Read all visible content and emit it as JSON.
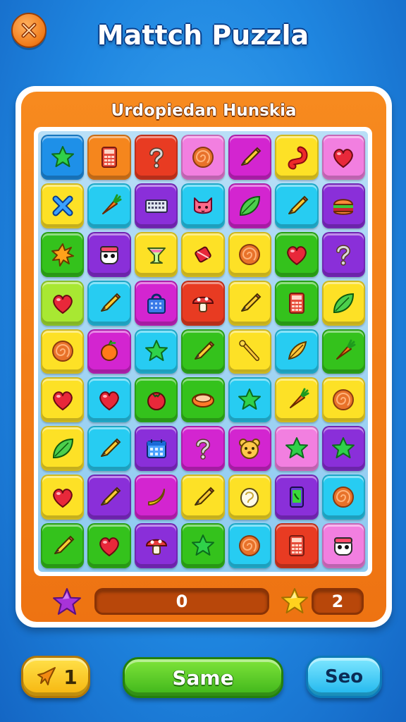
{
  "header": {
    "title": "Mattch Puzzla",
    "close_icon": "close-icon"
  },
  "panel": {
    "subtitle": "Urdopiedan Hunskia"
  },
  "board": {
    "columns": 7,
    "rows": 9,
    "tiles": [
      {
        "color": "blue",
        "icon": "star"
      },
      {
        "color": "orange",
        "icon": "calculator"
      },
      {
        "color": "red",
        "icon": "question"
      },
      {
        "color": "pink",
        "icon": "swirl"
      },
      {
        "color": "magenta",
        "icon": "pencil"
      },
      {
        "color": "yellow",
        "icon": "hook"
      },
      {
        "color": "pink",
        "icon": "heart"
      },
      {
        "color": "yellow",
        "icon": "cross"
      },
      {
        "color": "cyan",
        "icon": "carrot"
      },
      {
        "color": "purple",
        "icon": "keyboard"
      },
      {
        "color": "cyan",
        "icon": "cat"
      },
      {
        "color": "magenta",
        "icon": "leaf"
      },
      {
        "color": "cyan",
        "icon": "pencil"
      },
      {
        "color": "purple",
        "icon": "burger"
      },
      {
        "color": "green",
        "icon": "burst"
      },
      {
        "color": "purple",
        "icon": "face"
      },
      {
        "color": "yellow",
        "icon": "cup"
      },
      {
        "color": "yellow",
        "icon": "candy"
      },
      {
        "color": "yellow",
        "icon": "swirl"
      },
      {
        "color": "green",
        "icon": "heart"
      },
      {
        "color": "purple",
        "icon": "question"
      },
      {
        "color": "lime",
        "icon": "heart"
      },
      {
        "color": "cyan",
        "icon": "pencil"
      },
      {
        "color": "magenta",
        "icon": "bag"
      },
      {
        "color": "red",
        "icon": "mushroom"
      },
      {
        "color": "yellow",
        "icon": "pencil"
      },
      {
        "color": "green",
        "icon": "calculator"
      },
      {
        "color": "yellow",
        "icon": "leaf"
      },
      {
        "color": "yellow",
        "icon": "swirl"
      },
      {
        "color": "magenta",
        "icon": "fruit"
      },
      {
        "color": "cyan",
        "icon": "star"
      },
      {
        "color": "green",
        "icon": "pencil"
      },
      {
        "color": "yellow",
        "icon": "wand"
      },
      {
        "color": "cyan",
        "icon": "feather"
      },
      {
        "color": "green",
        "icon": "carrot"
      },
      {
        "color": "yellow",
        "icon": "heart"
      },
      {
        "color": "cyan",
        "icon": "heart"
      },
      {
        "color": "green",
        "icon": "tomato"
      },
      {
        "color": "green",
        "icon": "bowl"
      },
      {
        "color": "cyan",
        "icon": "star"
      },
      {
        "color": "yellow",
        "icon": "carrot"
      },
      {
        "color": "yellow",
        "icon": "swirl"
      },
      {
        "color": "yellow",
        "icon": "leaf"
      },
      {
        "color": "cyan",
        "icon": "pencil"
      },
      {
        "color": "purple",
        "icon": "calendar"
      },
      {
        "color": "magenta",
        "icon": "question"
      },
      {
        "color": "magenta",
        "icon": "bear"
      },
      {
        "color": "pink",
        "icon": "star"
      },
      {
        "color": "purple",
        "icon": "star"
      },
      {
        "color": "yellow",
        "icon": "heart"
      },
      {
        "color": "purple",
        "icon": "pencil"
      },
      {
        "color": "magenta",
        "icon": "banana"
      },
      {
        "color": "yellow",
        "icon": "pencil"
      },
      {
        "color": "yellow",
        "icon": "egg"
      },
      {
        "color": "purple",
        "icon": "phone"
      },
      {
        "color": "cyan",
        "icon": "swirl"
      },
      {
        "color": "green",
        "icon": "pencil"
      },
      {
        "color": "green",
        "icon": "heart"
      },
      {
        "color": "purple",
        "icon": "mushroom"
      },
      {
        "color": "green",
        "icon": "star"
      },
      {
        "color": "cyan",
        "icon": "swirl"
      },
      {
        "color": "red",
        "icon": "calculator"
      },
      {
        "color": "pink",
        "icon": "face"
      }
    ]
  },
  "status": {
    "score": "0",
    "moves": "2",
    "left_icon": "star-icon",
    "right_icon": "star-icon"
  },
  "footer": {
    "boost_count": "1",
    "boost_icon": "rocket-icon",
    "main_button": "Same",
    "right_button": "Seo"
  },
  "colors": {
    "blue": "#1e90e8",
    "orange": "#f5861d",
    "red": "#e83b22",
    "pink": "#f27fe0",
    "magenta": "#d325d0",
    "yellow": "#fde126",
    "cyan": "#27ccf2",
    "purple": "#8a2fd9",
    "green": "#34c21c",
    "lime": "#a8e832"
  }
}
